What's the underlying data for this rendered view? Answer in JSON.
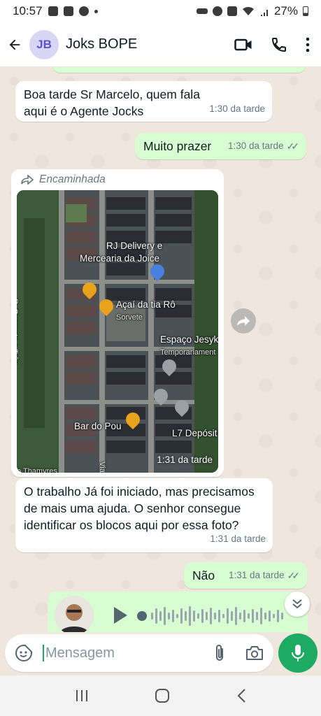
{
  "status_bar": {
    "time": "10:57",
    "battery": "27%"
  },
  "header": {
    "avatar_initials": "JB",
    "contact_name": "Joks BOPE"
  },
  "messages": [
    {
      "type": "incoming",
      "text": "Boa tarde Sr Marcelo, quem fala aqui é o Agente Jocks",
      "time": "1:30 da tarde"
    },
    {
      "type": "outgoing",
      "text": "Muito prazer",
      "time": "1:30 da tarde"
    },
    {
      "type": "forwarded_map",
      "forwarded_label": "Encaminhada",
      "time": "1:31 da tarde",
      "map_labels": {
        "rj": "RJ Delivery e",
        "mercearia": "Mercearia da Joice",
        "acai": "Açaí da tia Rô",
        "sorvete": "Sorvete",
        "espaco": "Espaço Jesyk",
        "temporariamente": "Temporariament",
        "bar": "Bar do Pou",
        "deposito": "L7 Depósit",
        "street_left": "R. Quarenta e Três",
        "street_bottom": "o Thamyres",
        "via": "Via"
      }
    },
    {
      "type": "incoming",
      "text": "O trabalho Já foi iniciado, mas precisamos de mais uma ajuda. O senhor consegue identificar os blocos aqui por essa foto?",
      "time": "1:31 da tarde"
    },
    {
      "type": "outgoing",
      "text": "Não",
      "time": "1:31 da tarde"
    }
  ],
  "composer": {
    "placeholder": "Mensagem"
  },
  "colors": {
    "accent": "#1daa61",
    "outgoing_bubble": "#d9fdd3",
    "incoming_bubble": "#ffffff",
    "chat_background": "#efe7dd"
  },
  "icons": [
    "back-arrow-icon",
    "video-call-icon",
    "phone-icon",
    "more-options-icon",
    "forward-icon",
    "play-icon",
    "sticker-icon",
    "attach-icon",
    "camera-icon",
    "mic-icon",
    "chevron-down-icon"
  ]
}
